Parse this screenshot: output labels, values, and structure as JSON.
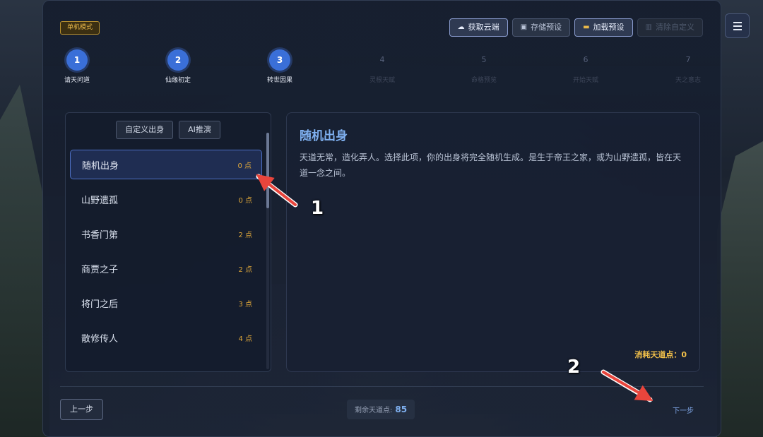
{
  "mode_badge": "单机模式",
  "toolbar": {
    "cloud": {
      "label": "获取云端",
      "icon": "cloud-icon"
    },
    "save": {
      "label": "存储预设",
      "icon": "lock-icon"
    },
    "load": {
      "label": "加载预设",
      "icon": "folder-icon"
    },
    "clear": {
      "label": "清除自定义",
      "icon": "trash-icon"
    }
  },
  "steps": [
    {
      "num": "1",
      "label": "请天问道"
    },
    {
      "num": "2",
      "label": "仙缘初定"
    },
    {
      "num": "3",
      "label": "转世因果"
    },
    {
      "num": "4",
      "label": "灵根天赋"
    },
    {
      "num": "5",
      "label": "命格预览"
    },
    {
      "num": "6",
      "label": "开始天赋"
    },
    {
      "num": "7",
      "label": "天之意志"
    }
  ],
  "left_tabs": [
    "自定义出身",
    "AI推演"
  ],
  "origins": [
    {
      "name": "随机出身",
      "points": "0 点"
    },
    {
      "name": "山野遗孤",
      "points": "0 点"
    },
    {
      "name": "书香门第",
      "points": "2 点"
    },
    {
      "name": "商贾之子",
      "points": "2 点"
    },
    {
      "name": "将门之后",
      "points": "3 点"
    },
    {
      "name": "散修传人",
      "points": "4 点"
    }
  ],
  "detail": {
    "title": "随机出身",
    "description": "天道无常，造化弄人。选择此项，你的出身将完全随机生成。是生于帝王之家，或为山野遗孤，皆在天道一念之间。",
    "cost": "消耗天道点：0"
  },
  "footer": {
    "prev": "上一步",
    "remaining_label": "剩余天道点:",
    "remaining_value": "85",
    "next": "下一步"
  },
  "annotations": [
    "1",
    "2"
  ],
  "colors": {
    "accent": "#3a6fd8",
    "gold": "#e0a83a",
    "arrow": "#e8453c"
  }
}
